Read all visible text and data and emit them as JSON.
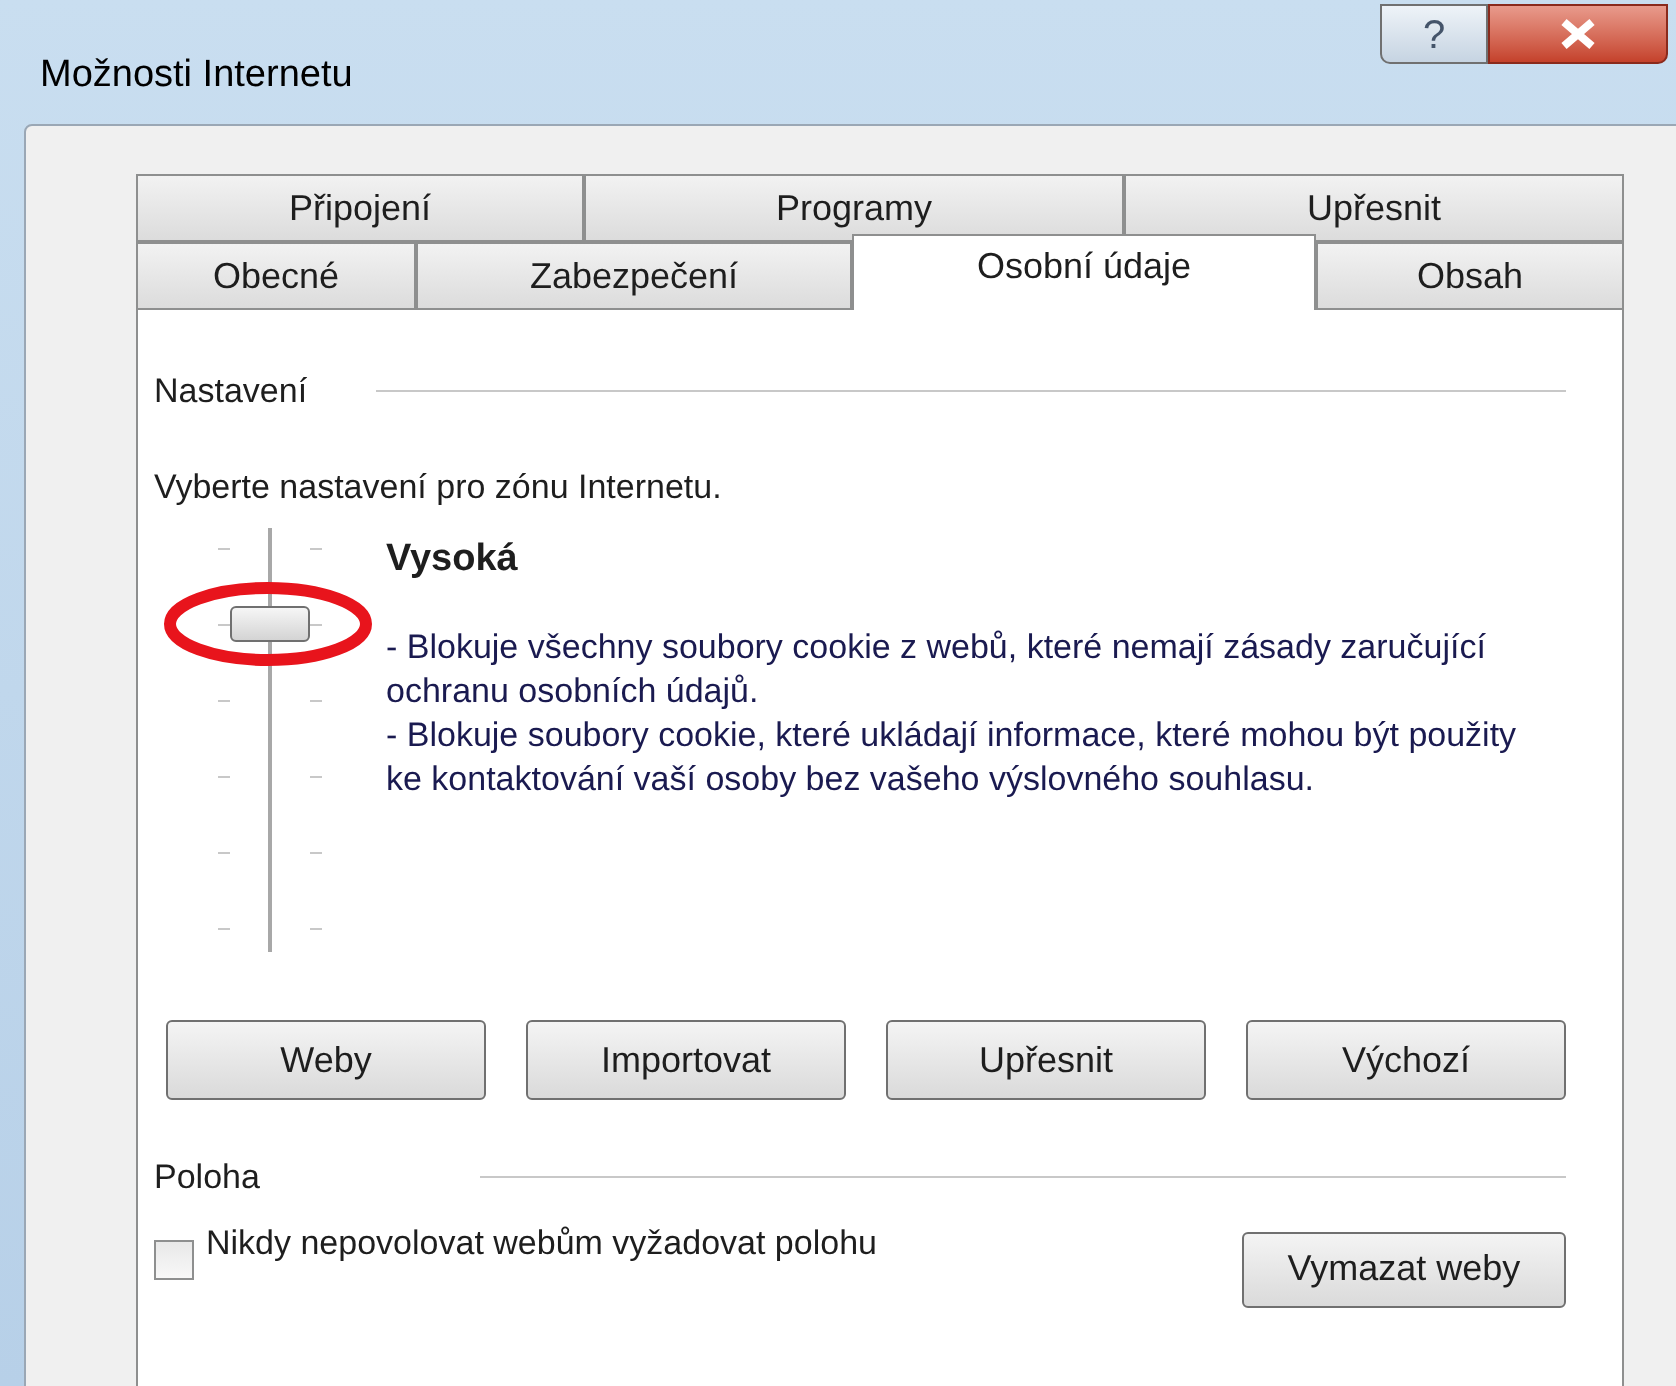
{
  "window": {
    "title": "Možnosti Internetu",
    "help_button": "?"
  },
  "tab_rows": [
    [
      {
        "label": "Připojení",
        "selected": false
      },
      {
        "label": "Programy",
        "selected": false
      },
      {
        "label": "Upřesnit",
        "selected": false
      }
    ],
    [
      {
        "label": "Obecné",
        "selected": false
      },
      {
        "label": "Zabezpečení",
        "selected": false
      },
      {
        "label": "Osobní údaje",
        "selected": true
      },
      {
        "label": "Obsah",
        "selected": false
      }
    ]
  ],
  "settings": {
    "heading": "Nastavení",
    "intro": "Vyberte nastavení pro zónu Internetu.",
    "slider": {
      "level": 0.8,
      "highlighted": true
    },
    "level_name": "Vysoká",
    "description": [
      "- Blokuje všechny soubory cookie z webů, které nemají zásady zaručující ochranu osobních údajů.",
      "- Blokuje soubory cookie, které ukládají informace, které mohou být použity ke kontaktování vaší osoby bez vašeho výslovného souhlasu."
    ],
    "buttons": [
      "Weby",
      "Importovat",
      "Upřesnit",
      "Výchozí"
    ]
  },
  "location": {
    "heading": "Poloha",
    "checkbox": {
      "label": "Nikdy nepovolovat webům vyžadovat polohu",
      "checked": false
    },
    "button": "Vymazat weby"
  }
}
